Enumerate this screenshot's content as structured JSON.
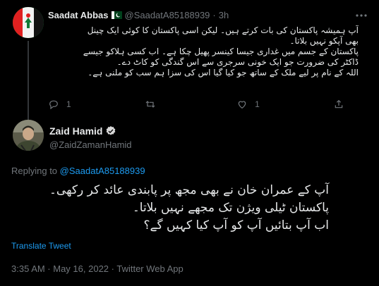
{
  "parent_tweet": {
    "name": "Saadat Abbas",
    "handle": "@SaadatA85188939",
    "separator": "·",
    "time": "3h",
    "lines": [
      "آپ ہمیشہ پاکستان کی بات کرتے ہیں۔ لیکن اسی پاکستان کا کوئی ایک چینل",
      "بھی آپکو نہیں بلاتا۔",
      "پاکستان کے جسم میں غداری جیسا کینسر پھیل چکا ہے۔ اب کسی ہلاکو جیسے",
      "ڈاکٹر کی ضرورت جو ایک خونی سرجری سے اس گندگی کو کاٹ دے۔",
      "اللہ کے نام پر لیے ملک کے ساتھ جو کیا گیا اس کی سزا ہم سب کو ملنی ہے۔"
    ],
    "actions": {
      "replies": "1",
      "retweets": "",
      "likes": "1"
    }
  },
  "main_tweet": {
    "name": "Zaid Hamid",
    "handle": "@ZaidZamanHamid",
    "replying_prefix": "Replying to",
    "replying_to": "@SaadatA85188939",
    "lines": [
      "آپ کے عمران خان نے بھی مجھ پر پابندی عائد کر رکھی۔",
      "پاکستان ٹیلی ویژن تک مجھے نہیں  بلاتا۔",
      "اب آپ بتائیں آپ کو آپ کیا کہیں گے؟"
    ],
    "translate_label": "Translate Tweet",
    "timestamp": "3:35 AM · May 16, 2022 · Twitter Web App"
  },
  "colors": {
    "background": "#000000",
    "text": "#e7e9ea",
    "muted": "#71767b",
    "link": "#1d9bf0",
    "verified": "#d9d9d9",
    "divider": "#333639"
  },
  "icons": [
    "reply-icon",
    "retweet-icon",
    "like-icon",
    "share-icon",
    "more-icon",
    "verified-icon",
    "pakistan-flag-icon"
  ]
}
